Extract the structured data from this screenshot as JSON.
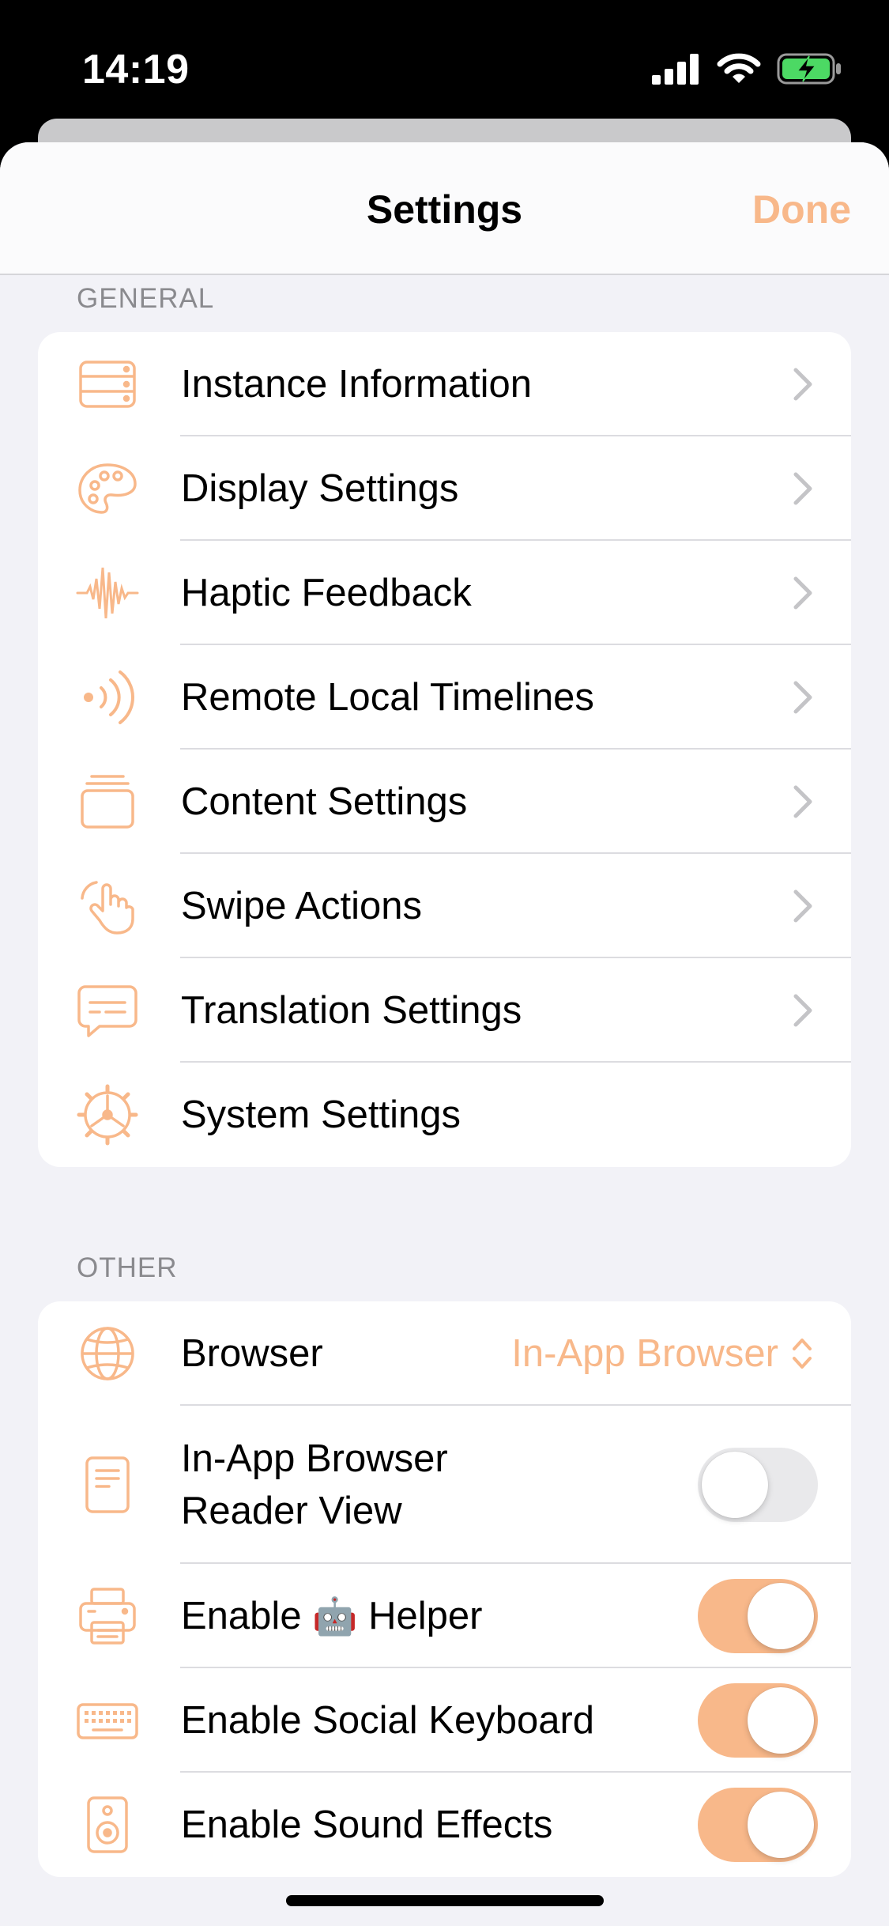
{
  "status_bar": {
    "time": "14:19"
  },
  "nav": {
    "title": "Settings",
    "done_label": "Done"
  },
  "sections": {
    "general": {
      "header": "GENERAL",
      "rows": [
        {
          "label": "Instance Information",
          "icon": "server-rack-icon"
        },
        {
          "label": "Display Settings",
          "icon": "palette-icon"
        },
        {
          "label": "Haptic Feedback",
          "icon": "waveform-icon"
        },
        {
          "label": "Remote Local Timelines",
          "icon": "dot-radiowaves-right-icon"
        },
        {
          "label": "Content Settings",
          "icon": "rectangle-stack-icon"
        },
        {
          "label": "Swipe Actions",
          "icon": "hand-tap-icon"
        },
        {
          "label": "Translation Settings",
          "icon": "text-bubble-icon"
        },
        {
          "label": "System Settings",
          "icon": "gear-icon"
        }
      ]
    },
    "other": {
      "header": "OTHER",
      "browser": {
        "label": "Browser",
        "value": "In-App Browser"
      },
      "reader_view": {
        "label_line1": "In-App Browser",
        "label_line2": "Reader View",
        "enabled": false
      },
      "helper": {
        "label_before": "Enable",
        "emoji": "🤖",
        "label_after": "Helper",
        "enabled": true
      },
      "social_keyboard": {
        "label": "Enable Social Keyboard",
        "enabled": true
      },
      "sound_effects": {
        "label": "Enable Sound Effects",
        "enabled": true
      }
    }
  },
  "colors": {
    "accent": "#f8b88a",
    "toggle_off": "#e9e9eb",
    "background": "#f2f2f7"
  }
}
